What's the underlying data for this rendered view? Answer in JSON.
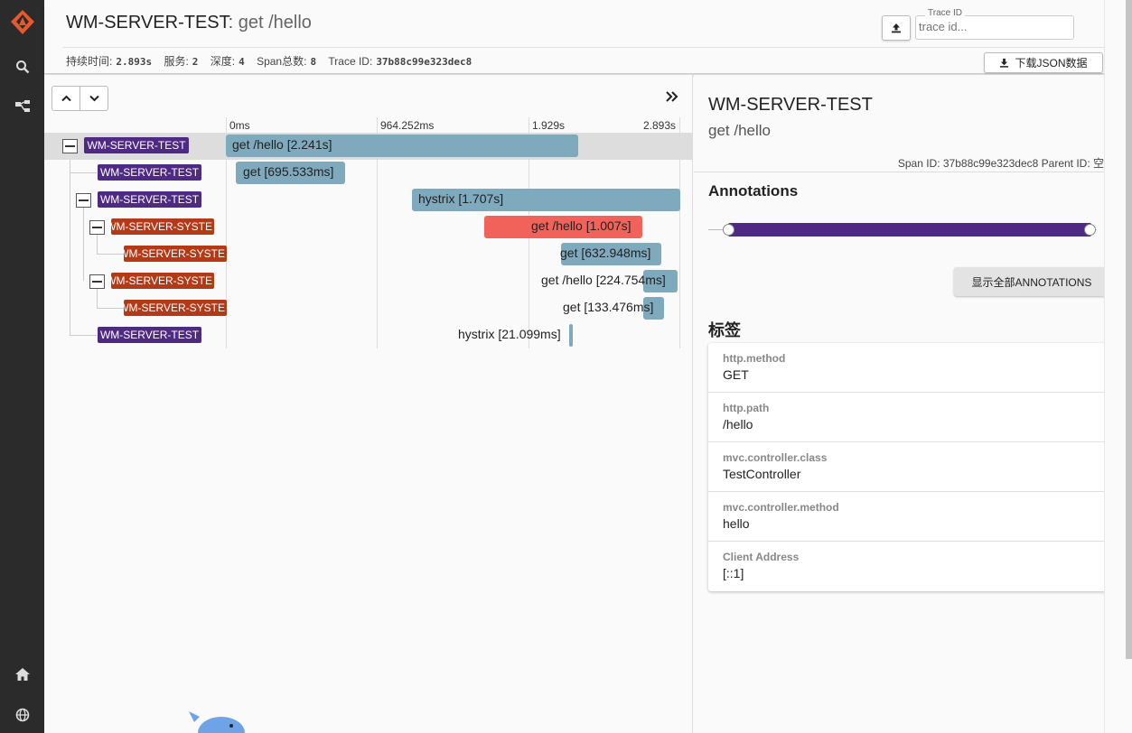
{
  "header": {
    "service": "WM-SERVER-TEST",
    "separator": ":",
    "span_name": " get /hello",
    "summary": [
      {
        "label": "持续时间:",
        "value": "2.893s"
      },
      {
        "label": "服务:",
        "value": "2"
      },
      {
        "label": "深度:",
        "value": "4"
      },
      {
        "label": "Span总数:",
        "value": "8"
      },
      {
        "label": "Trace ID:",
        "value": "37b88c99e323dec8"
      }
    ],
    "trace_id_label": "Trace ID",
    "trace_id_placeholder": "trace id...",
    "download_label": "下载JSON数据"
  },
  "timeline": {
    "ticks": [
      "0ms",
      "964.252ms",
      "1.929s",
      "2.893s"
    ],
    "spans": [
      {
        "service": "WM-SERVER-TEST",
        "label": "get /hello [2.241s]",
        "color": "purple"
      },
      {
        "service": "WM-SERVER-TEST",
        "label": "get [695.533ms]",
        "color": "purple"
      },
      {
        "service": "WM-SERVER-TEST",
        "label": "hystrix [1.707s]",
        "color": "purple"
      },
      {
        "service": "WM-SERVER-SYSTE",
        "label": "get /hello [1.007s]",
        "color": "orange"
      },
      {
        "service": "WM-SERVER-SYSTE",
        "label": "get [632.948ms]",
        "color": "orange"
      },
      {
        "service": "WM-SERVER-SYSTE",
        "label": "get /hello [224.754ms]",
        "color": "orange"
      },
      {
        "service": "WM-SERVER-SYSTE",
        "label": "get [133.476ms]",
        "color": "orange"
      },
      {
        "service": "WM-SERVER-TEST",
        "label": "hystrix [21.099ms]",
        "color": "purple"
      }
    ]
  },
  "detail": {
    "service": "WM-SERVER-TEST",
    "span_name": "get /hello",
    "ids": "Span ID: 37b88c99e323dec8   Parent ID: 空",
    "annotations_title": "Annotations",
    "show_all_label": "显示全部ANNOTATIONS",
    "tags_title": "标签",
    "tags": [
      {
        "key": "http.method",
        "value": "GET"
      },
      {
        "key": "http.path",
        "value": "/hello"
      },
      {
        "key": "mvc.controller.class",
        "value": "TestController"
      },
      {
        "key": "mvc.controller.method",
        "value": "hello"
      },
      {
        "key": "Client Address",
        "value": "[::1]"
      }
    ]
  },
  "colors": {
    "purple": "#4e2a84",
    "orange": "#b33a16",
    "bar_blue": "#7fa9bd",
    "bar_red": "#f0625a",
    "logo_orange": "#e8582c"
  },
  "icons": [
    "zipkin-logo-icon",
    "search-icon",
    "dependencies-icon",
    "home-icon",
    "globe-icon",
    "upload-icon",
    "download-icon",
    "chevron-up-icon",
    "chevron-down-icon",
    "double-chevron-right-icon"
  ]
}
